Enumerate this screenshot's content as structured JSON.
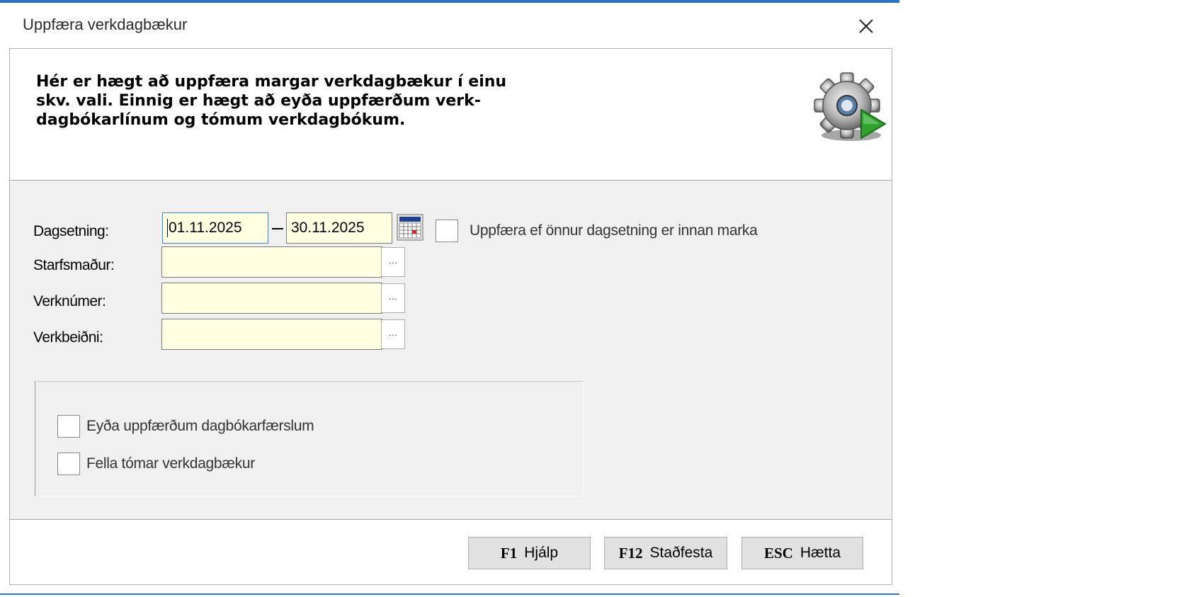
{
  "window": {
    "title": "Uppfæra verkdagbækur",
    "close_glyph": "×"
  },
  "header": {
    "description": "Hér er hægt að uppfæra margar verkdagbækur í einu\nskv. vali.  Einnig er hægt að eyða uppfærðum verk-\ndagbókarlínum og tómum verkdagbókum.",
    "icon": "gear-run-icon"
  },
  "form": {
    "date_label": "Dagsetning:",
    "date_from": "01.11.2025",
    "date_to": "30.11.2025",
    "update_other_date_label": "Uppfæra ef önnur dagsetning er innan marka",
    "employee_label": "Starfsmaður:",
    "employee_value": "",
    "job_number_label": "Verknúmer:",
    "job_number_value": "",
    "work_request_label": "Verkbeiðni:",
    "work_request_value": "",
    "lookup_glyph": "···"
  },
  "options": {
    "delete_updated_label": "Eyða uppfærðum dagbókarfærslum",
    "drop_empty_label": "Fella tómar verkdagbækur"
  },
  "buttons": {
    "help_key": "F1",
    "help_label": "Hjálp",
    "confirm_key": "F12",
    "confirm_label": "Staðfesta",
    "cancel_key": "ESC",
    "cancel_label": "Hætta"
  },
  "colors": {
    "accent": "#2f73c6",
    "field_bg": "#ffffe1",
    "panel_bg": "#f0f0f0",
    "gear_play": "#2ea12e"
  }
}
